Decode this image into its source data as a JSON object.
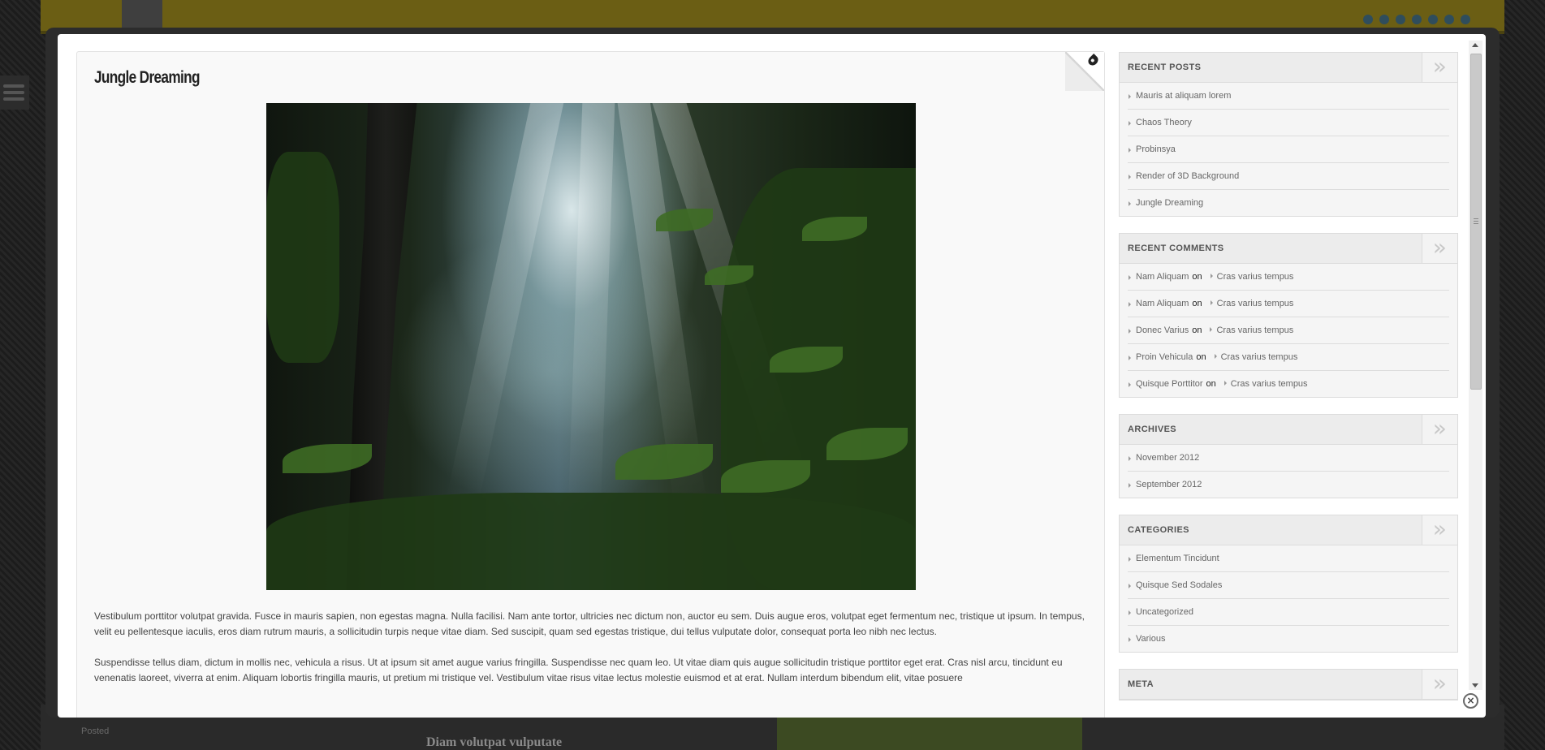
{
  "background": {
    "nav_text": "",
    "bottom_title": "Diam volutpat vulputate",
    "bottom_left": "Posted"
  },
  "post": {
    "title": "Jungle Dreaming",
    "image_alt": "Sunlight streaming through jungle foliage",
    "paragraphs": [
      "Vestibulum porttitor volutpat gravida. Fusce in mauris sapien, non egestas magna. Nulla facilisi. Nam ante tortor, ultricies nec dictum non, auctor eu sem. Duis augue eros, volutpat eget fermentum nec, tristique ut ipsum. In tempus, velit eu pellentesque iaculis, eros diam rutrum mauris, a sollicitudin turpis neque vitae diam. Sed suscipit, quam sed egestas tristique, dui tellus vulputate dolor, consequat porta leo nibh nec lectus.",
      "Suspendisse tellus diam, dictum in mollis nec, vehicula a risus. Ut at ipsum sit amet augue varius fringilla. Suspendisse nec quam leo. Ut vitae diam quis augue sollicitudin tristique porttitor eget erat. Cras nisl arcu, tincidunt eu venenatis laoreet, viverra at enim. Aliquam lobortis fringilla mauris, ut pretium mi tristique vel. Vestibulum vitae risus vitae lectus molestie euismod et at erat. Nullam interdum bibendum elit, vitae posuere"
    ]
  },
  "sidebar": {
    "recent_posts": {
      "title": "RECENT POSTS",
      "chevron": "»",
      "items": [
        "Mauris at aliquam lorem",
        "Chaos Theory",
        "Probinsya",
        "Render of 3D Background",
        "Jungle Dreaming"
      ]
    },
    "recent_comments": {
      "title": "RECENT COMMENTS",
      "chevron": "»",
      "on": "on",
      "items": [
        {
          "author": "Nam Aliquam",
          "post": "Cras varius tempus"
        },
        {
          "author": "Nam Aliquam",
          "post": "Cras varius tempus"
        },
        {
          "author": "Donec Varius",
          "post": "Cras varius tempus"
        },
        {
          "author": "Proin Vehicula",
          "post": "Cras varius tempus"
        },
        {
          "author": "Quisque Porttitor",
          "post": "Cras varius tempus"
        }
      ]
    },
    "archives": {
      "title": "ARCHIVES",
      "chevron": "»",
      "items": [
        "November 2012",
        "September 2012"
      ]
    },
    "categories": {
      "title": "CATEGORIES",
      "chevron": "»",
      "items": [
        "Elementum Tincidunt",
        "Quisque Sed Sodales",
        "Uncategorized",
        "Various"
      ]
    },
    "meta": {
      "title": "META",
      "chevron": "»"
    }
  },
  "lightbox": {
    "close_label": "×"
  },
  "icons": {
    "corner": "eye-icon",
    "close": "close-icon"
  }
}
